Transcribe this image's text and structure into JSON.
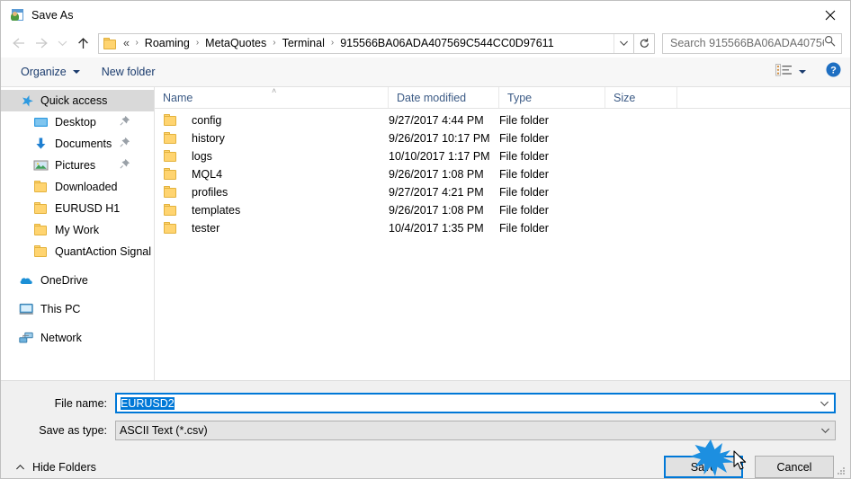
{
  "window": {
    "title": "Save As",
    "icon": "save-as-icon",
    "close_label": "✕"
  },
  "nav": {
    "back": "back-arrow-icon",
    "forward": "forward-arrow-icon",
    "recent": "recent-locations-icon",
    "up": "up-arrow-icon"
  },
  "address": {
    "prefix": "«",
    "crumbs": [
      "Roaming",
      "MetaQuotes",
      "Terminal",
      "915566BA06ADA407569C544CC0D97611"
    ],
    "separator": "›",
    "dropdown_icon": "chevron-down-icon",
    "refresh_icon": "refresh-icon"
  },
  "search": {
    "placeholder": "Search 915566BA06ADA40756...",
    "icon": "search-icon"
  },
  "toolbar": {
    "organize_label": "Organize",
    "new_folder_label": "New folder",
    "view_icon": "view-layout-icon",
    "help_icon": "help-icon",
    "help_label": "?"
  },
  "sidebar": {
    "items": [
      {
        "label": "Quick access",
        "icon": "star-icon",
        "selected": true,
        "indent": false,
        "pinned": false
      },
      {
        "label": "Desktop",
        "icon": "desktop-icon",
        "selected": false,
        "indent": true,
        "pinned": true
      },
      {
        "label": "Documents",
        "icon": "documents-icon",
        "selected": false,
        "indent": true,
        "pinned": true
      },
      {
        "label": "Pictures",
        "icon": "pictures-icon",
        "selected": false,
        "indent": true,
        "pinned": true
      },
      {
        "label": "Downloaded",
        "icon": "folder-icon",
        "selected": false,
        "indent": true,
        "pinned": false
      },
      {
        "label": "EURUSD H1",
        "icon": "folder-icon",
        "selected": false,
        "indent": true,
        "pinned": false
      },
      {
        "label": "My Work",
        "icon": "folder-icon",
        "selected": false,
        "indent": true,
        "pinned": false
      },
      {
        "label": "QuantAction Signal",
        "icon": "folder-icon",
        "selected": false,
        "indent": true,
        "pinned": false
      },
      {
        "label": "OneDrive",
        "icon": "onedrive-icon",
        "selected": false,
        "indent": false,
        "pinned": false,
        "gap_before": true
      },
      {
        "label": "This PC",
        "icon": "thispc-icon",
        "selected": false,
        "indent": false,
        "pinned": false,
        "gap_before": true
      },
      {
        "label": "Network",
        "icon": "network-icon",
        "selected": false,
        "indent": false,
        "pinned": false,
        "gap_before": true
      }
    ]
  },
  "filelist": {
    "columns": [
      "Name",
      "Date modified",
      "Type",
      "Size"
    ],
    "sort_indicator": "˄",
    "rows": [
      {
        "name": "config",
        "date": "9/27/2017 4:44 PM",
        "type": "File folder",
        "size": ""
      },
      {
        "name": "history",
        "date": "9/26/2017 10:17 PM",
        "type": "File folder",
        "size": ""
      },
      {
        "name": "logs",
        "date": "10/10/2017 1:17 PM",
        "type": "File folder",
        "size": ""
      },
      {
        "name": "MQL4",
        "date": "9/26/2017 1:08 PM",
        "type": "File folder",
        "size": ""
      },
      {
        "name": "profiles",
        "date": "9/27/2017 4:21 PM",
        "type": "File folder",
        "size": ""
      },
      {
        "name": "templates",
        "date": "9/26/2017 1:08 PM",
        "type": "File folder",
        "size": ""
      },
      {
        "name": "tester",
        "date": "10/4/2017 1:35 PM",
        "type": "File folder",
        "size": ""
      }
    ]
  },
  "form": {
    "filename_label": "File name:",
    "filename_value": "EURUSD2",
    "filetype_label": "Save as type:",
    "filetype_value": "ASCII Text (*.csv)",
    "dropdown_icon": "chevron-down-icon"
  },
  "footer": {
    "hide_folders_label": "Hide Folders",
    "hide_folders_icon": "chevron-up-icon",
    "save_label": "Save",
    "cancel_label": "Cancel",
    "resize_grip": "resize-grip-icon"
  },
  "colors": {
    "accent": "#0078d7",
    "folder": "#ffd470",
    "header_text": "#3b5a85",
    "selection": "#d9d9d9"
  }
}
